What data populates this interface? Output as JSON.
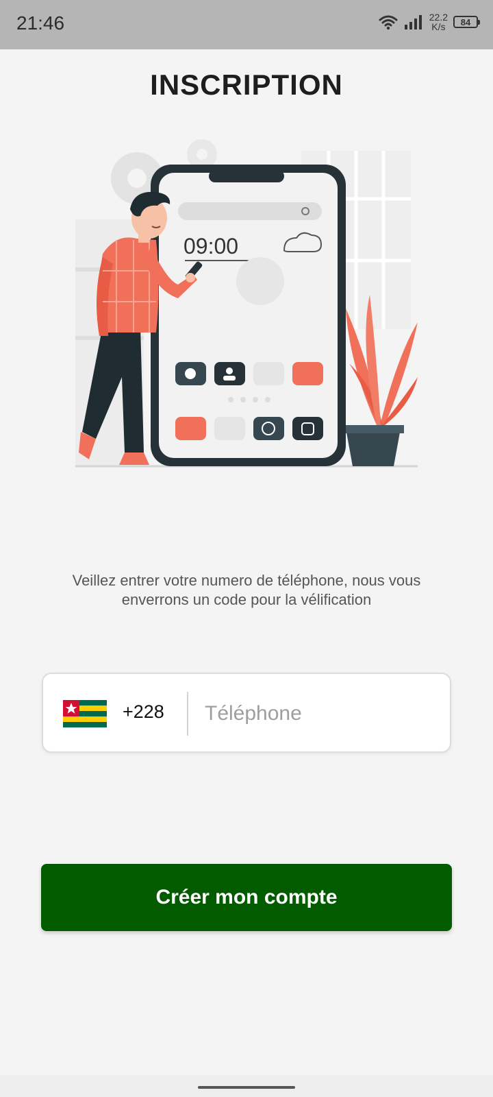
{
  "status_bar": {
    "time": "21:46",
    "net_speed_value": "22.2",
    "net_speed_unit": "K/s",
    "battery_level": "84",
    "icons": [
      "wifi-icon",
      "signal-icon",
      "battery-icon"
    ]
  },
  "page": {
    "title": "INSCRIPTION",
    "instruction": "Veillez entrer votre numero de téléphone, nous vous enverrons un code pour la vélification"
  },
  "illustration": {
    "clock_text": "09:00"
  },
  "phone_field": {
    "country_flag": "togo-flag-icon",
    "dial_code": "+228",
    "placeholder": "Téléphone",
    "value": ""
  },
  "actions": {
    "create_account_label": "Créer mon compte"
  },
  "colors": {
    "primary_button": "#035b00",
    "accent_illustration": "#f0705a",
    "dark_illustration": "#263238"
  }
}
